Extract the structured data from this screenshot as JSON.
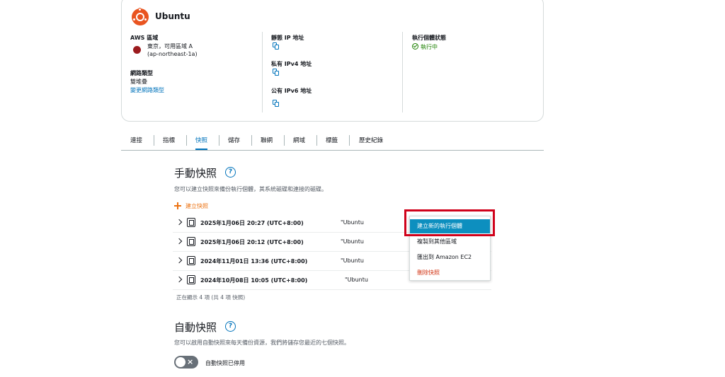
{
  "instance": {
    "name": "Ubuntu",
    "region_label": "AWS 區域",
    "region_value_line1": "東京，可用區域 A",
    "region_value_line2": "(ap-northeast-1a)",
    "network_type_label": "網路類型",
    "network_type_value": "雙堆疊",
    "change_network_link": "變更網路類型",
    "static_ip_label": "靜態 IP 地址",
    "private_ipv4_label": "私有 IPv4 地址",
    "public_ipv6_label": "公有 IPv6 地址",
    "status_label": "執行個體狀態",
    "status_value": "執行中",
    "brand_color": "#e95420",
    "status_color": "#1d8102"
  },
  "tabs": [
    {
      "label": "連接"
    },
    {
      "label": "指標"
    },
    {
      "label": "快照",
      "active": true
    },
    {
      "label": "儲存"
    },
    {
      "label": "聯網"
    },
    {
      "label": "網域"
    },
    {
      "label": "標籤"
    },
    {
      "label": "歷史紀錄"
    }
  ],
  "manual": {
    "title": "手動快照",
    "help": "?",
    "description": "您可以建立快照來備份執行個體，其系統磁碟和連接的磁碟。",
    "create_link": "建立快照",
    "snapshots": [
      {
        "date": "2025年1月06日 20:27 (UTC+8:00)",
        "source": "\"Ubuntu"
      },
      {
        "date": "2025年1月06日 20:12 (UTC+8:00)",
        "source": "\"Ubuntu"
      },
      {
        "date": "2024年11月01日 13:36 (UTC+8:00)",
        "source": "\"Ubuntu"
      },
      {
        "date": "2024年10月08日 10:05 (UTC+8:00)",
        "source": "\"Ubuntu"
      }
    ],
    "count_text": "正在顯示 4 項 (共 4 項 快照)"
  },
  "context_menu": {
    "items": [
      {
        "label": "建立新的執行個體"
      },
      {
        "label": "複製到其他區域"
      },
      {
        "label": "匯出到 Amazon EC2"
      },
      {
        "label": "刪除快照"
      }
    ]
  },
  "auto": {
    "title": "自動快照",
    "help": "?",
    "description": "您可以啟用自動快照來每天備份資源，我們將儲存您最近的七個快照。",
    "toggle_label": "自動快照已停用",
    "toggle_icon": "×"
  },
  "colors": {
    "link": "#0073bb",
    "accent": "#ec7211",
    "danger": "#d13212",
    "menu_primary": "#0d8fbf",
    "highlight": "#d0021b"
  }
}
